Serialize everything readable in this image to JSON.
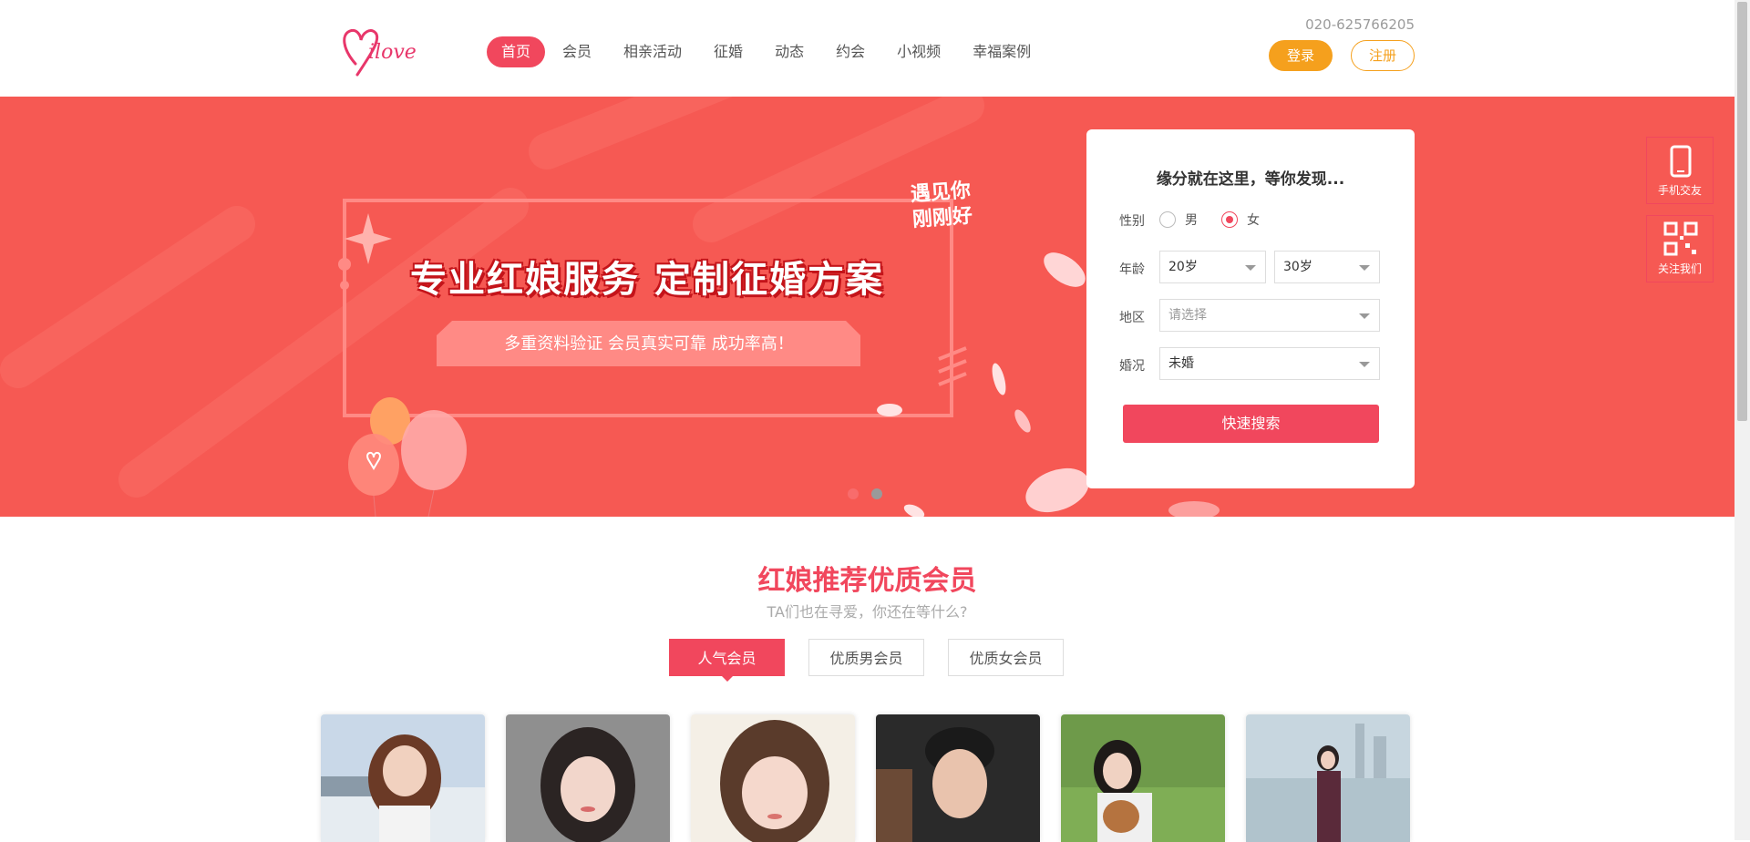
{
  "header": {
    "logo_text": "Milove",
    "phone": "020-625766205",
    "nav": [
      {
        "label": "首页",
        "active": true
      },
      {
        "label": "会员"
      },
      {
        "label": "相亲活动"
      },
      {
        "label": "征婚"
      },
      {
        "label": "动态"
      },
      {
        "label": "约会"
      },
      {
        "label": "小视频"
      },
      {
        "label": "幸福案例"
      }
    ],
    "login_label": "登录",
    "register_label": "注册"
  },
  "banner": {
    "headline": "专业红娘服务  定制征婚方案",
    "subline": "多重资料验证    会员真实可靠   成功率高！",
    "stamp": "遇见你\n刚刚好",
    "slides": 2,
    "active_slide": 1
  },
  "search": {
    "title": "缘分就在这里，等你发现...",
    "gender_label": "性别",
    "gender_options": [
      "男",
      "女"
    ],
    "gender_selected": "女",
    "age_label": "年龄",
    "age_min": "20岁",
    "age_max": "30岁",
    "region_label": "地区",
    "region_placeholder": "请选择",
    "marital_label": "婚况",
    "marital_value": "未婚",
    "search_button": "快速搜索"
  },
  "side": {
    "mobile_label": "手机交友",
    "follow_label": "关注我们"
  },
  "members": {
    "title": "红娘推荐优质会员",
    "subtitle": "TA们也在寻爱，你还在等什么?",
    "tabs": [
      "人气会员",
      "优质男会员",
      "优质女会员"
    ],
    "active_tab": "人气会员"
  },
  "colors": {
    "brand": "#f1475d",
    "banner_bg": "#f65953",
    "login_orange": "#f5a01d"
  }
}
